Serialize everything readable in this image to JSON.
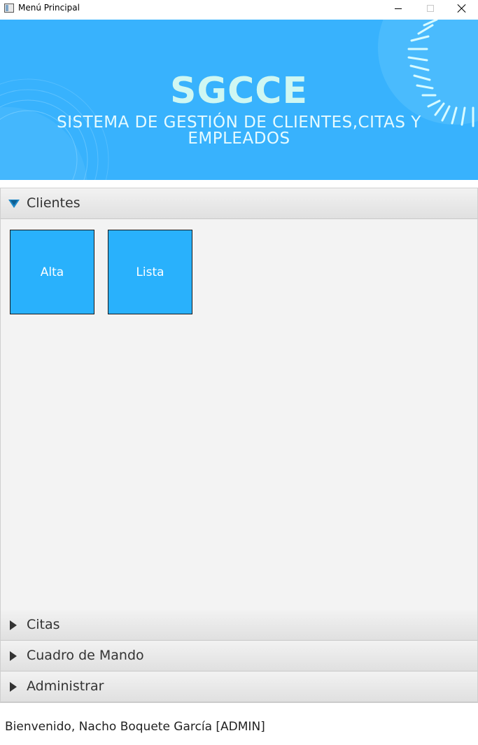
{
  "window": {
    "title": "Menú Principal"
  },
  "banner": {
    "title": "SGCCE",
    "subtitle": "SISTEMA DE GESTIÓN DE CLIENTES,CITAS Y EMPLEADOS",
    "background_color": "#38b2fd",
    "title_color": "#cff7f2"
  },
  "accordion": {
    "panes": [
      {
        "label": "Clientes",
        "expanded": true,
        "buttons": [
          {
            "label": "Alta"
          },
          {
            "label": "Lista"
          }
        ]
      },
      {
        "label": "Citas",
        "expanded": false
      },
      {
        "label": "Cuadro de Mando",
        "expanded": false
      },
      {
        "label": "Administrar",
        "expanded": false
      }
    ],
    "tile_color": "#29b1fc"
  },
  "status": {
    "welcome": "Bienvenido, Nacho Boquete García [ADMIN]"
  },
  "icons": {
    "app": "app-window-icon",
    "minimize": "minimize-icon",
    "maximize": "maximize-icon",
    "close": "close-icon",
    "expanded": "triangle-down-icon",
    "collapsed": "triangle-right-icon"
  }
}
